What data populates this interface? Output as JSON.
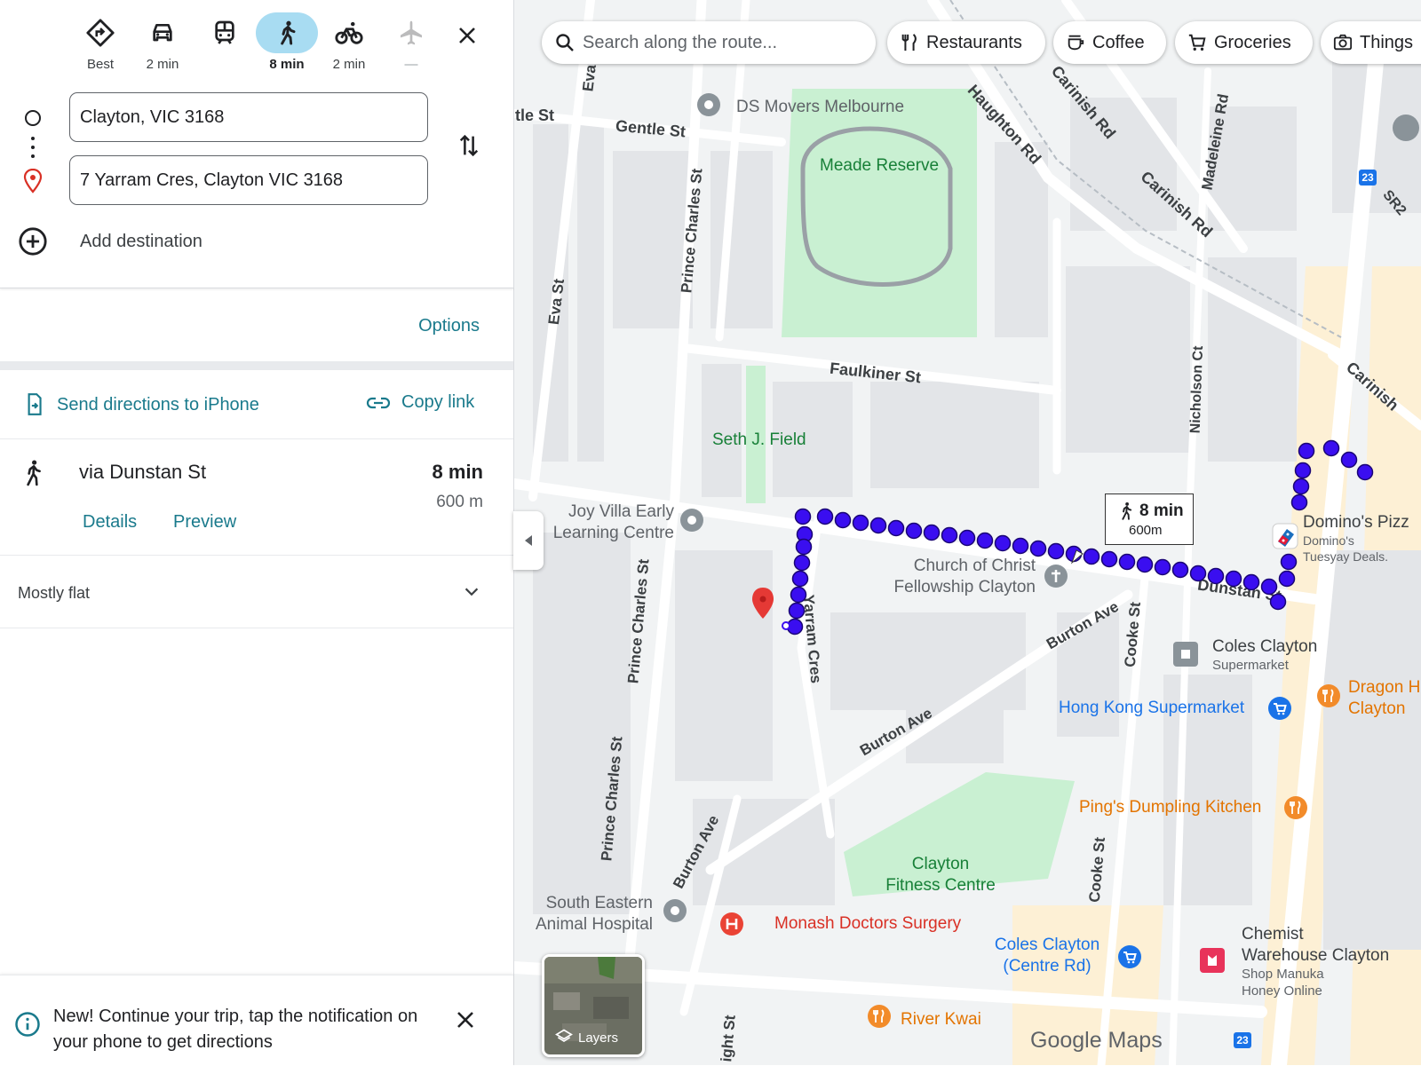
{
  "travel_modes": [
    {
      "name": "best",
      "label": "Best"
    },
    {
      "name": "driving",
      "label": "2 min"
    },
    {
      "name": "transit",
      "label": ""
    },
    {
      "name": "walking",
      "label": "8 min",
      "active": true
    },
    {
      "name": "cycling",
      "label": "2 min"
    },
    {
      "name": "flights",
      "label": "—",
      "disabled": true
    }
  ],
  "origin": "Clayton, VIC 3168",
  "destination": "7 Yarram Cres, Clayton VIC 3168",
  "add_destination": "Add destination",
  "options_label": "Options",
  "send_directions": "Send directions to iPhone",
  "copy_link": "Copy link",
  "route": {
    "via": "via Dunstan St",
    "duration": "8 min",
    "distance": "600 m",
    "details": "Details",
    "preview": "Preview",
    "elevation": "Mostly flat"
  },
  "notification": "New! Continue your trip, tap the notification on your phone to get directions",
  "map": {
    "search_placeholder": "Search along the route...",
    "chips": [
      "Restaurants",
      "Coffee",
      "Groceries",
      "Things"
    ],
    "callout": {
      "duration": "8 min",
      "distance": "600m"
    },
    "layers_label": "Layers",
    "logo": "Google Maps",
    "streets": {
      "gentle_st": "Gentle St",
      "gentle_st_left": "ntle St",
      "eva_st": "Eva St",
      "eva_st_top": "Eva",
      "prince_charles_n": "Prince Charles St",
      "prince_charles_m": "Prince Charles St",
      "prince_charles_s": "Prince Charles St",
      "faulkiner_st": "Faulkiner St",
      "haughton_rd": "Haughton Rd",
      "carinish_1": "Carinish Rd",
      "carinish_2": "Carinish Rd",
      "carinish_3": "Carinish",
      "madeleine_rd": "Madeleine Rd",
      "nicholson_ct": "Nicholson Ct",
      "dunstan_st": "Dunstan St",
      "yarram_cres": "Yarram Cres",
      "burton_ave_1": "Burton Ave",
      "burton_ave_2": "Burton Ave",
      "burton_ave_3": "Burton Ave",
      "cooke_st_1": "Cooke St",
      "cooke_st_2": "Cooke St",
      "sr2": "SR2",
      "ight_st": "ight St"
    },
    "pois": {
      "ds_movers": "DS Movers Melbourne",
      "meade_reserve": "Meade Reserve",
      "seth_field": "Seth J. Field",
      "joy_villa_1": "Joy Villa Early",
      "joy_villa_2": "Learning Centre",
      "church_1": "Church of Christ",
      "church_2": "Fellowship Clayton",
      "dominos": "Domino's Pizz",
      "dominos_sub1": "Domino's",
      "dominos_sub2": "Tuesyay Deals.",
      "coles_clayton": "Coles Clayton",
      "supermarket": "Supermarket",
      "hong_kong": "Hong Kong Supermarket",
      "dragon_1": "Dragon H",
      "dragon_2": "Clayton",
      "pings": "Ping's Dumpling Kitchen",
      "fitness_1": "Clayton",
      "fitness_2": "Fitness Centre",
      "south_eastern_1": "South Eastern",
      "south_eastern_2": "Animal Hospital",
      "monash": "Monash Doctors Surgery",
      "coles_centre_1": "Coles Clayton",
      "coles_centre_2": "(Centre Rd)",
      "chemist_1": "Chemist",
      "chemist_2": "Warehouse Clayton",
      "chemist_3": "Shop Manuka",
      "chemist_4": "Honey Online",
      "river_kwai": "River Kwai"
    },
    "route_badges": [
      "23",
      "23"
    ],
    "colors": {
      "route": "#3a0ef0",
      "park": "#c9f0d2",
      "road": "#ffffff",
      "land": "#f1f3f4",
      "building": "#e3e5e8",
      "commercial": "#fdf0d5",
      "teal": "#1a7a8c"
    }
  }
}
